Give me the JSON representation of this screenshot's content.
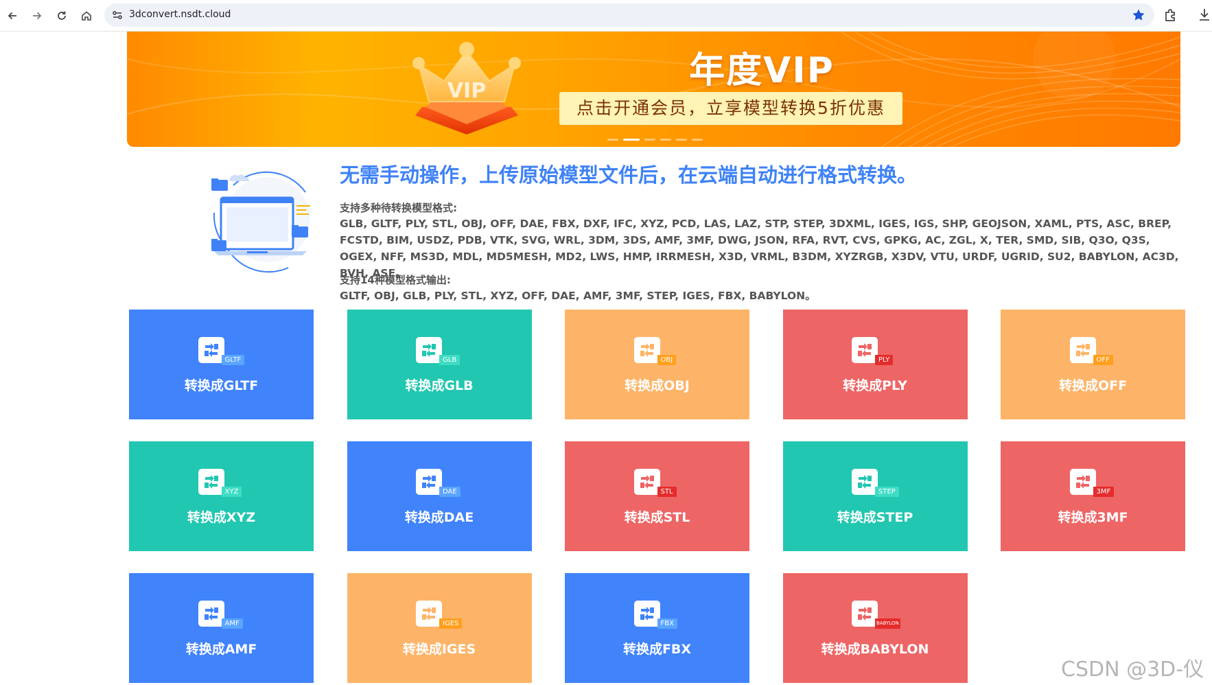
{
  "browser": {
    "url": "3dconvert.nsdt.cloud"
  },
  "banner": {
    "crown_text": "VIP",
    "title": "年度VIP",
    "subtitle": "点击开通会员，立享模型转换5折优惠"
  },
  "intro": {
    "title": "无需手动操作，上传原始模型文件后，在云端自动进行格式转换。",
    "input_label": "支持多种待转换模型格式:",
    "input_formats": "GLB, GLTF, PLY, STL, OBJ, OFF, DAE, FBX, DXF, IFC, XYZ, PCD, LAS, LAZ, STP, STEP, 3DXML, IGES, IGS, SHP, GEOJSON, XAML, PTS, ASC, BREP, FCSTD, BIM, USDZ, PDB, VTK, SVG, WRL, 3DM, 3DS, AMF, 3MF, DWG, JSON, RFA, RVT, CVS, GPKG, AC, ZGL, X, TER, SMD, SIB, Q3O, Q3S, OGEX, NFF, MS3D, MDL, MD5MESH, MD2, LWS, HMP, IRRMESH, X3D, VRML, B3DM, XYZRGB, X3DV, VTU, URDF, UGRID, SU2, BABYLON, AC3D, BVH, ASE。",
    "output_label": "支持14种模型格式输出:",
    "output_formats": "GLTF, OBJ, GLB, PLY, STL, XYZ, OFF, DAE, AMF, 3MF, STEP, IGES, FBX, BABYLON。"
  },
  "colors": {
    "blue": "#4083fb",
    "teal": "#21c7b0",
    "orange": "#feb468",
    "red": "#ee6565",
    "badge_blue": "#5aa5ff",
    "badge_teal": "#3fdcc5",
    "badge_orange": "#ff9f1c",
    "badge_red": "#e52c2c"
  },
  "cards": [
    {
      "format": "GLTF",
      "label": "转换成GLTF",
      "color": "blue"
    },
    {
      "format": "GLB",
      "label": "转换成GLB",
      "color": "teal"
    },
    {
      "format": "OBJ",
      "label": "转换成OBJ",
      "color": "orange"
    },
    {
      "format": "PLY",
      "label": "转换成PLY",
      "color": "red"
    },
    {
      "format": "OFF",
      "label": "转换成OFF",
      "color": "orange"
    },
    {
      "format": "XYZ",
      "label": "转换成XYZ",
      "color": "teal"
    },
    {
      "format": "DAE",
      "label": "转换成DAE",
      "color": "blue"
    },
    {
      "format": "STL",
      "label": "转换成STL",
      "color": "red"
    },
    {
      "format": "STEP",
      "label": "转换成STEP",
      "color": "teal"
    },
    {
      "format": "3MF",
      "label": "转换成3MF",
      "color": "red"
    },
    {
      "format": "AMF",
      "label": "转换成AMF",
      "color": "blue"
    },
    {
      "format": "IGES",
      "label": "转换成IGES",
      "color": "orange"
    },
    {
      "format": "FBX",
      "label": "转换成FBX",
      "color": "blue"
    },
    {
      "format": "BABYLON",
      "label": "转换成BABYLON",
      "color": "red"
    }
  ],
  "watermark": "CSDN @3D-仪"
}
